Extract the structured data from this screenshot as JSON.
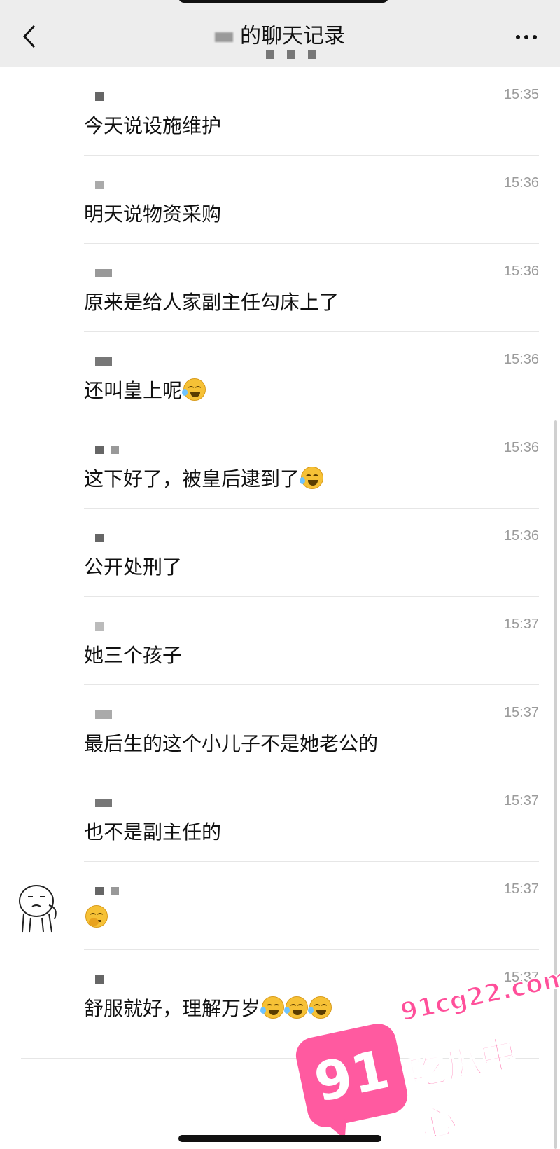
{
  "header": {
    "title": "的聊天记录",
    "back_icon": "chevron-left-icon",
    "more_icon": "more-icon"
  },
  "messages": [
    {
      "time": "15:35",
      "text": "今天说设施维护",
      "emojis": []
    },
    {
      "time": "15:36",
      "text": "明天说物资采购",
      "emojis": []
    },
    {
      "time": "15:36",
      "text": "原来是给人家副主任勾床上了",
      "emojis": []
    },
    {
      "time": "15:36",
      "text": "还叫皇上呢",
      "emojis": [
        "laugh-cry"
      ]
    },
    {
      "time": "15:36",
      "text": "这下好了，被皇后逮到了",
      "emojis": [
        "laugh-cry"
      ]
    },
    {
      "time": "15:36",
      "text": "公开处刑了",
      "emojis": []
    },
    {
      "time": "15:37",
      "text": "她三个孩子",
      "emojis": []
    },
    {
      "time": "15:37",
      "text": "最后生的这个小儿子不是她老公的",
      "emojis": []
    },
    {
      "time": "15:37",
      "text": "也不是副主任的",
      "emojis": []
    },
    {
      "time": "15:37",
      "text": "",
      "emojis": [
        "thinking"
      ]
    },
    {
      "time": "15:37",
      "text": "舒服就好，理解万岁",
      "emojis": [
        "laugh-cry",
        "laugh-cry",
        "laugh-cry"
      ]
    }
  ],
  "watermark": {
    "domain": "91cg22.com",
    "badge": "91",
    "name": "吃瓜中心",
    "color": "#ff5aa0"
  },
  "colors": {
    "header_bg": "#ededed",
    "time_text": "#9b9b9b",
    "divider": "#e6e6e6"
  }
}
